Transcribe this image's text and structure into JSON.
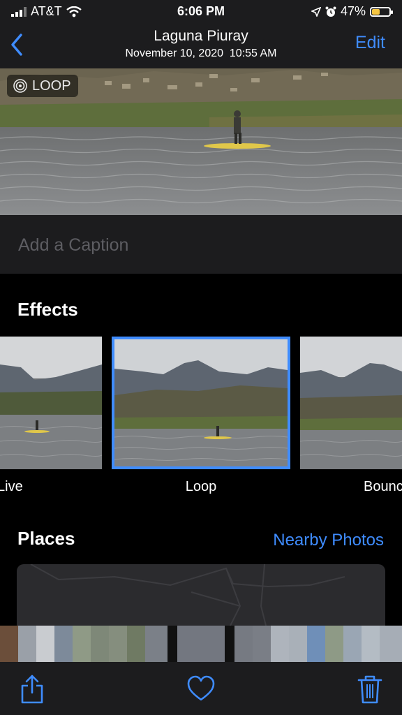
{
  "status_bar": {
    "carrier": "AT&T",
    "time": "6:06 PM",
    "battery": "47%",
    "battery_level": 0.47,
    "icons": [
      "signal-icon",
      "wifi-icon",
      "location-icon",
      "alarm-icon",
      "battery-icon"
    ]
  },
  "nav": {
    "back_icon": "chevron-left-icon",
    "title": "Laguna Piuray",
    "subtitle": "November 10, 2020  10:55 AM",
    "edit_label": "Edit"
  },
  "photo": {
    "badge_label": "LOOP",
    "badge_icon": "loop-icon"
  },
  "caption": {
    "placeholder": "Add a Caption"
  },
  "effects": {
    "title": "Effects",
    "items": [
      {
        "label": "Live",
        "selected": false
      },
      {
        "label": "Loop",
        "selected": true
      },
      {
        "label": "Bounce",
        "selected": false
      }
    ]
  },
  "places": {
    "title": "Places",
    "nearby_label": "Nearby Photos"
  },
  "toolbar": {
    "icons": [
      "share-icon",
      "heart-icon",
      "trash-icon"
    ]
  },
  "colors": {
    "accent": "#3f8cff",
    "bar_bg": "#1c1c1e",
    "battery": "#f5c542"
  }
}
